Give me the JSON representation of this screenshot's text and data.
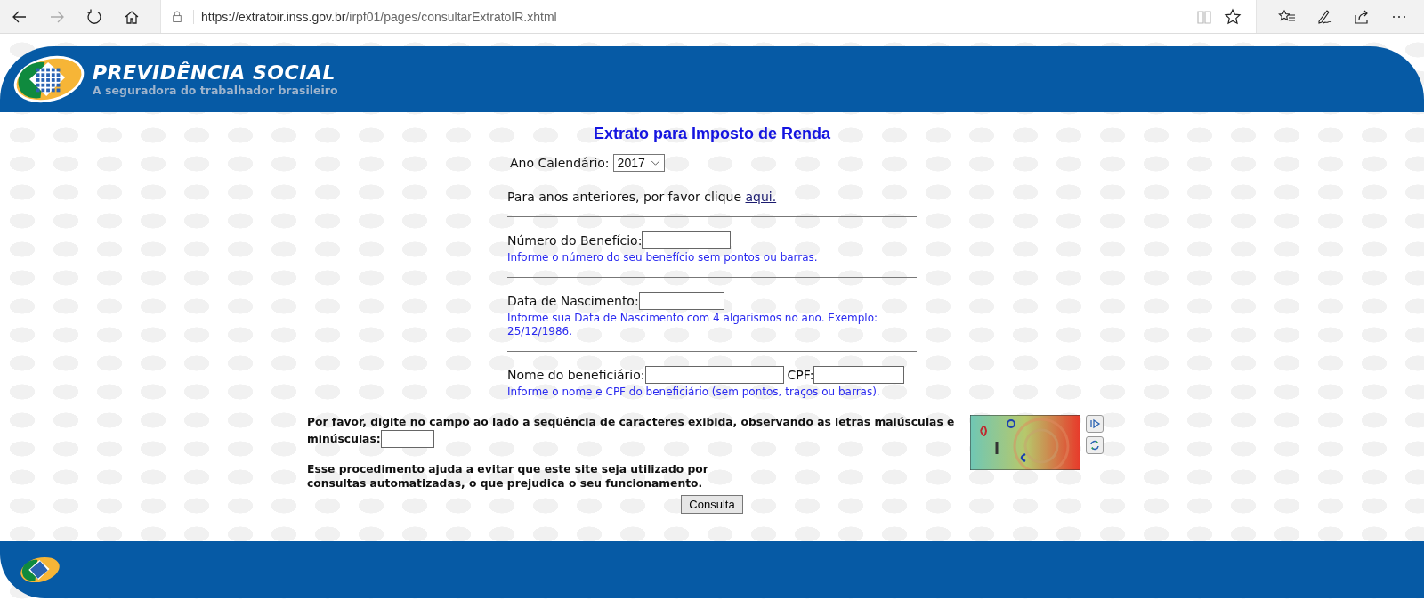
{
  "browser": {
    "url_host": "https://extratoir.inss.gov.br",
    "url_path": "/irpf01/pages/consultarExtratoIR.xhtml"
  },
  "header": {
    "brand": "PREVIDÊNCIA SOCIAL",
    "tagline": "A seguradora do trabalhador brasileiro"
  },
  "form": {
    "title": "Extrato para Imposto de Renda",
    "year": {
      "label": "Ano Calendário:",
      "value": "2017"
    },
    "previous": {
      "text": "Para anos anteriores, por favor clique ",
      "link": "aqui."
    },
    "sections": [
      {
        "fields": [
          {
            "label": "Número do Benefício:"
          }
        ],
        "hint": "Informe o número do seu benefício sem pontos ou barras."
      },
      {
        "fields": [
          {
            "label": "Data de Nascimento:"
          }
        ],
        "hint": "Informe sua Data de Nascimento com 4 algarismos no ano. Exemplo: 25/12/1986."
      },
      {
        "fields": [
          {
            "label": "Nome do beneficiário:"
          },
          {
            "label": "CPF:"
          }
        ],
        "hint": "Informe o nome e CPF do beneficiário (sem pontos, traços ou barras)."
      }
    ],
    "captcha": {
      "instruction": "Por favor, digite no campo ao lado a seqüência de caracteres exibida, observando as letras maiúsculas e minúsculas:",
      "note": "Esse procedimento ajuda a evitar que este site seja utilizado por consultas automatizadas, o que prejudica o seu funcionamento."
    },
    "submit": "Consulta"
  }
}
